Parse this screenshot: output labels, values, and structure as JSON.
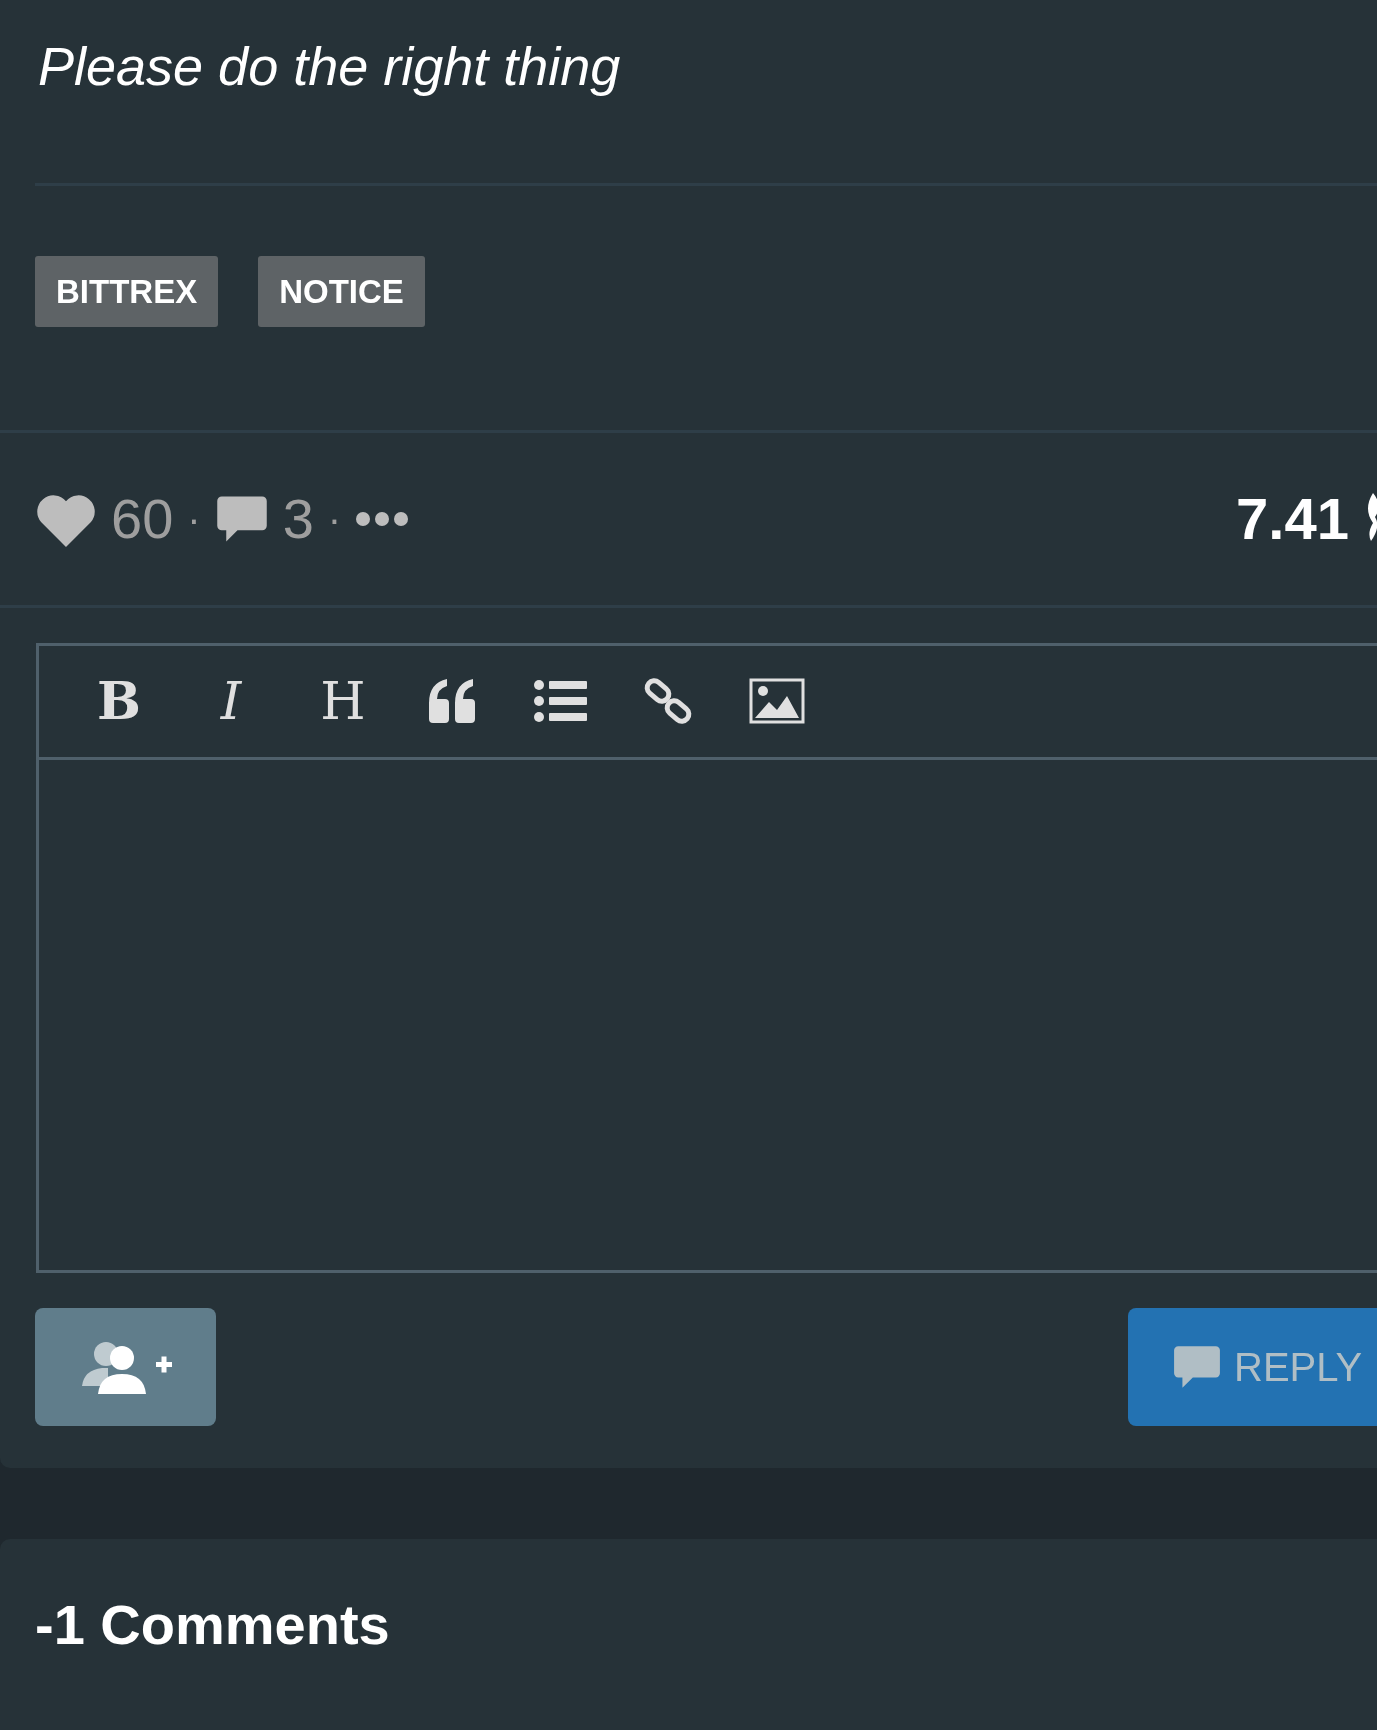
{
  "post": {
    "title": "Please do the right thing",
    "tags": [
      "BITTREX",
      "NOTICE"
    ],
    "stats": {
      "likes": "60",
      "separator_1": "·",
      "comments": "3",
      "separator_2": "·",
      "payout": "7.41"
    }
  },
  "editor": {
    "format_buttons": [
      "B",
      "I",
      "H"
    ]
  },
  "actions": {
    "reply": "REPLY"
  },
  "comments_header": "-1 Comments"
}
